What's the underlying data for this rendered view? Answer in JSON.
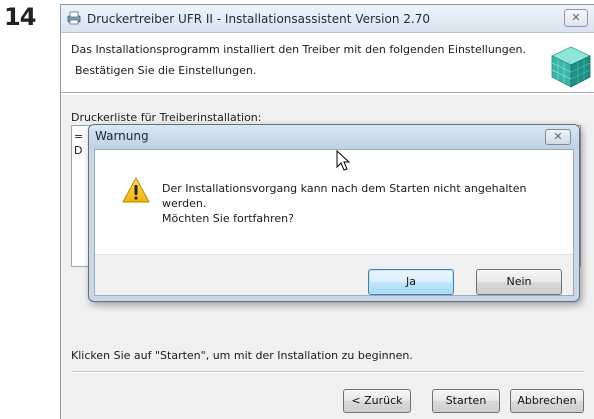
{
  "step": {
    "number": "14"
  },
  "main_window": {
    "title": "Druckertreiber UFR II - Installationsassistent Version 2.70",
    "close_label": "✕",
    "header": {
      "line1": "Das Installationsprogramm installiert den Treiber mit den folgenden Einstellungen.",
      "line2": "Bestätigen Sie die Einstellungen."
    },
    "list_label": "Druckerliste für Treiberinstallation:",
    "list_fragments": [
      "=",
      "D"
    ],
    "start_hint": "Klicken Sie auf \"Starten\", um mit der Installation zu beginnen.",
    "buttons": {
      "back": "< Zurück",
      "start": "Starten",
      "cancel": "Abbrechen"
    }
  },
  "dialog": {
    "title": "Warnung",
    "close_label": "✕",
    "message_lines": [
      "Der Installationsvorgang kann nach dem Starten nicht angehalten",
      "werden.",
      "Möchten Sie fortfahren?"
    ],
    "buttons": {
      "yes": "Ja",
      "no": "Nein"
    },
    "icon": "warning-icon"
  },
  "colors": {
    "titlebar": "#d9e4f0",
    "dialog_frame": "#c9d7e6",
    "default_button": "#a7d9f5",
    "warning": "#f5c518"
  }
}
